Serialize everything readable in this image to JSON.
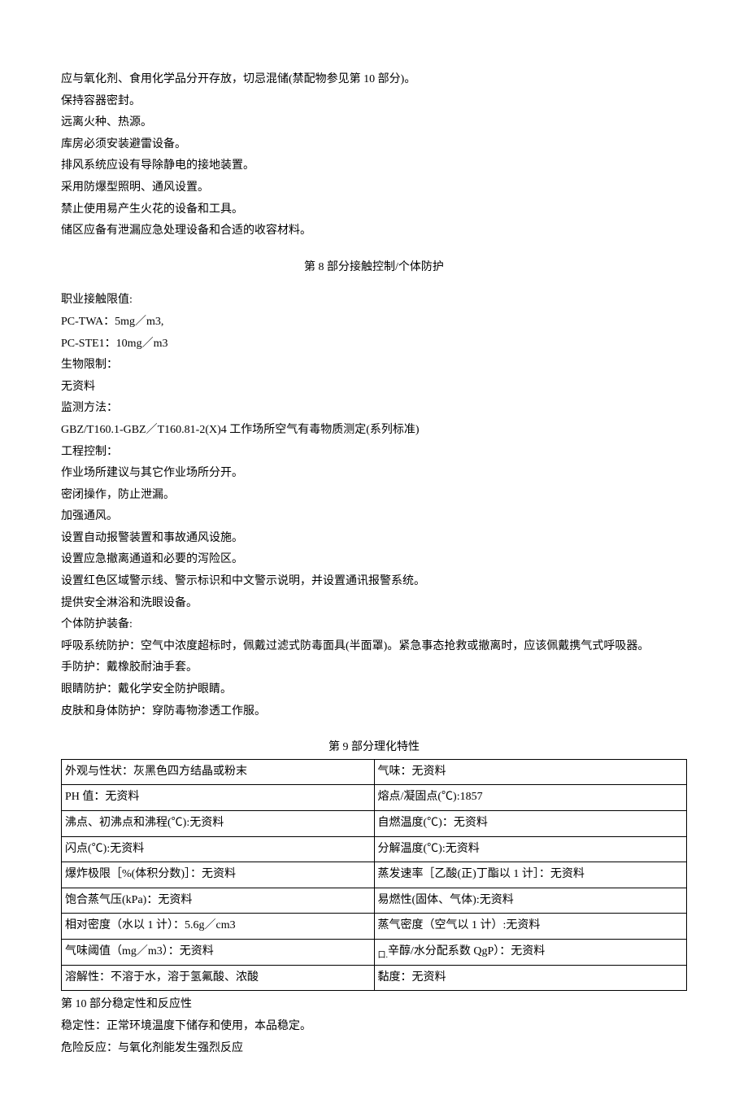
{
  "storage": {
    "lines": [
      "应与氧化剂、食用化学品分开存放，切忌混储(禁配物参见第 10 部分)。",
      "保持容器密封。",
      "远离火种、热源。",
      "库房必须安装避雷设备。",
      "排风系统应设有导除静电的接地装置。",
      "采用防爆型照明、通风设置。",
      "禁止使用易产生火花的设备和工具。",
      "储区应备有泄漏应急处理设备和合适的收容材料。"
    ]
  },
  "section8": {
    "title": "第 8 部分接触控制/个体防护",
    "lines": [
      "职业接触限值:",
      "PC-TWA：5mg／m3,",
      "PC-STE1：10mg／m3",
      "生物限制：",
      "无资料",
      "监测方法：",
      "GBZ/T160.1-GBZ／T160.81-2(X)4 工作场所空气有毒物质测定(系列标准)",
      "工程控制：",
      "作业场所建议与其它作业场所分开。",
      "密闭操作，防止泄漏。",
      "加强通风。",
      "设置自动报警装置和事故通风设施。",
      "设置应急撤离通道和必要的泻险区。",
      "设置红色区域警示线、警示标识和中文警示说明，并设置通讯报警系统。",
      "提供安全淋浴和洗眼设备。",
      "个体防护装备:",
      "呼吸系统防护：空气中浓度超标时，佩戴过滤式防毒面具(半面罩)。紧急事态抢救或撤离时，应该佩戴携气式呼吸器。",
      "手防护：戴橡胶耐油手套。",
      "眼睛防护：戴化学安全防护眼睛。",
      "皮肤和身体防护：穿防毒物渗透工作服。"
    ]
  },
  "section9": {
    "title": "第 9 部分理化特性",
    "rows": [
      {
        "l": "外观与性状：灰黑色四方结晶或粉末",
        "r": "气味：无资料"
      },
      {
        "l": "PH 值：无资料",
        "r": "熔点/凝固点(℃):1857"
      },
      {
        "l": "沸点、初沸点和沸程(℃):无资料",
        "r": "自燃温度(℃)：无资料"
      },
      {
        "l": "闪点(℃):无资料",
        "r": "分解温度(℃):无资料"
      },
      {
        "l": "爆炸极限［%(体积分数)］：无资料",
        "r": "蒸发速率［乙酸(正)丁酯以 1 计］：无资料"
      },
      {
        "l": "饱合蒸气压(kPa)：无资料",
        "r": "易燃性(固体、气体):无资料"
      },
      {
        "l": "相对密度（水以 1 计）：5.6g／cm3",
        "r": "蒸气密度（空气以 1 计）:无资料"
      },
      {
        "l": "气味阈值（mg／m3）：无资料",
        "r": ""
      },
      {
        "l": "溶解性：不溶于水，溶于氢氟酸、浓酸",
        "r": "黏度：无资料"
      }
    ],
    "row7_right_prefix": "口.",
    "row7_right_main": "辛醇/水分配系数 QgP）：无资料"
  },
  "section10": {
    "title": "第 10 部分稳定性和反应性",
    "lines": [
      "稳定性：正常环境温度下储存和使用，本品稳定。",
      "危险反应：与氧化剂能发生强烈反应"
    ]
  }
}
